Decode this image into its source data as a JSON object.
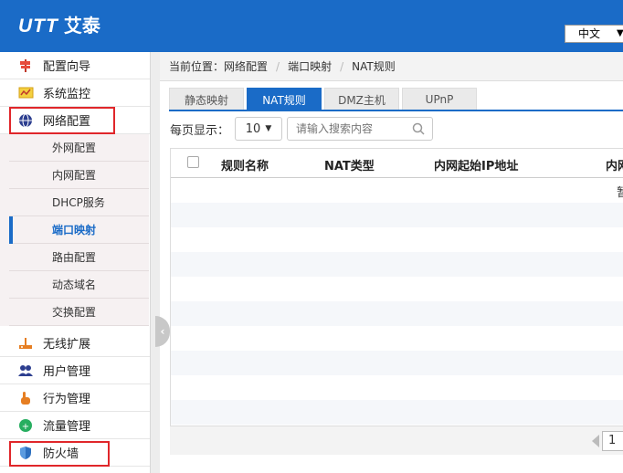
{
  "header": {
    "logo_en": "UTT",
    "logo_cn": "艾泰",
    "language": "中文",
    "language_caret": "▼"
  },
  "sidebar": {
    "items": [
      {
        "label": "配置向导",
        "icon": "signpost-icon"
      },
      {
        "label": "系统监控",
        "icon": "monitor-chart-icon"
      },
      {
        "label": "网络配置",
        "icon": "globe-network-icon"
      },
      {
        "label": "无线扩展",
        "icon": "router-icon"
      },
      {
        "label": "用户管理",
        "icon": "users-icon"
      },
      {
        "label": "行为管理",
        "icon": "hand-pointer-icon"
      },
      {
        "label": "流量管理",
        "icon": "traffic-icon"
      },
      {
        "label": "防火墙",
        "icon": "shield-icon"
      }
    ],
    "submenu": [
      {
        "label": "外网配置"
      },
      {
        "label": "内网配置"
      },
      {
        "label": "DHCP服务"
      },
      {
        "label": "端口映射",
        "active": true
      },
      {
        "label": "路由配置"
      },
      {
        "label": "动态域名"
      },
      {
        "label": "交换配置"
      }
    ]
  },
  "breadcrumb": {
    "prefix": "当前位置：",
    "levels": [
      "网络配置",
      "端口映射",
      "NAT规则"
    ]
  },
  "tabs": [
    {
      "label": "静态映射"
    },
    {
      "label": "NAT规则",
      "active": true
    },
    {
      "label": "DMZ主机"
    },
    {
      "label": "UPnP"
    }
  ],
  "toolbar": {
    "page_size_label": "每页显示：",
    "page_size": "10",
    "search_placeholder": "请输入搜索内容"
  },
  "table": {
    "columns": [
      "规则名称",
      "NAT类型",
      "内网起始IP地址",
      "内网"
    ],
    "empty_text": "暂"
  },
  "pager": {
    "page": "1"
  },
  "colors": {
    "brand_blue": "#1a6bc7",
    "highlight_red": "#e0262a"
  }
}
